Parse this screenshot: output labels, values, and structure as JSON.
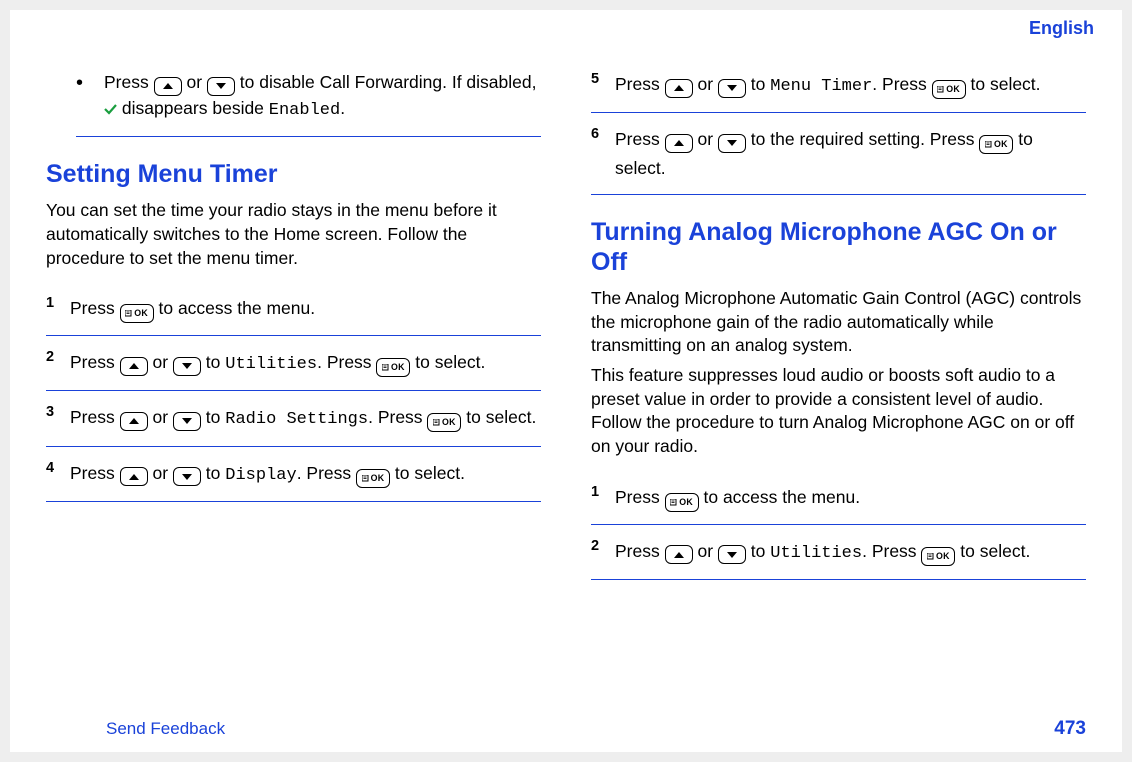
{
  "header": {
    "language": "English"
  },
  "col_left": {
    "bullet": {
      "text_a": "Press ",
      "text_b": " or ",
      "text_c": " to disable Call Forwarding. If disabled, ",
      "text_d": " disappears beside ",
      "code": "Enabled",
      "text_e": "."
    },
    "heading": "Setting Menu Timer",
    "intro": "You can set the time your radio stays in the menu before it automatically switches to the Home screen. Follow the procedure to set the menu timer.",
    "steps": [
      {
        "num": "1",
        "a": "Press ",
        "b": " to access the menu."
      },
      {
        "num": "2",
        "a": "Press ",
        "b": " or ",
        "c": " to ",
        "code": "Utilities",
        "d": ". Press ",
        "e": " to select."
      },
      {
        "num": "3",
        "a": "Press ",
        "b": " or ",
        "c": " to ",
        "code": "Radio Settings",
        "d": ". Press ",
        "e": " to select."
      },
      {
        "num": "4",
        "a": "Press ",
        "b": " or ",
        "c": " to ",
        "code": "Display",
        "d": ". Press ",
        "e": " to select."
      }
    ]
  },
  "col_right": {
    "steps_top": [
      {
        "num": "5",
        "a": "Press ",
        "b": " or ",
        "c": " to ",
        "code": "Menu Timer",
        "d": ". Press ",
        "e": " to select."
      },
      {
        "num": "6",
        "a": "Press ",
        "b": " or ",
        "c": " to the required setting. Press ",
        "d": " to select."
      }
    ],
    "heading": "Turning Analog Microphone AGC On or Off",
    "intro_a": "The Analog Microphone Automatic Gain Control (AGC) controls the microphone gain of the radio automatically while transmitting on an analog system.",
    "intro_b": "This feature suppresses loud audio or boosts soft audio to a preset value in order to provide a consistent level of audio. Follow the procedure to turn Analog Microphone AGC on or off on your radio.",
    "steps_bottom": [
      {
        "num": "1",
        "a": "Press ",
        "b": " to access the menu."
      },
      {
        "num": "2",
        "a": "Press ",
        "b": " or ",
        "c": " to ",
        "code": "Utilities",
        "d": ". Press ",
        "e": " to select."
      }
    ]
  },
  "footer": {
    "feedback": "Send Feedback",
    "page": "473"
  }
}
